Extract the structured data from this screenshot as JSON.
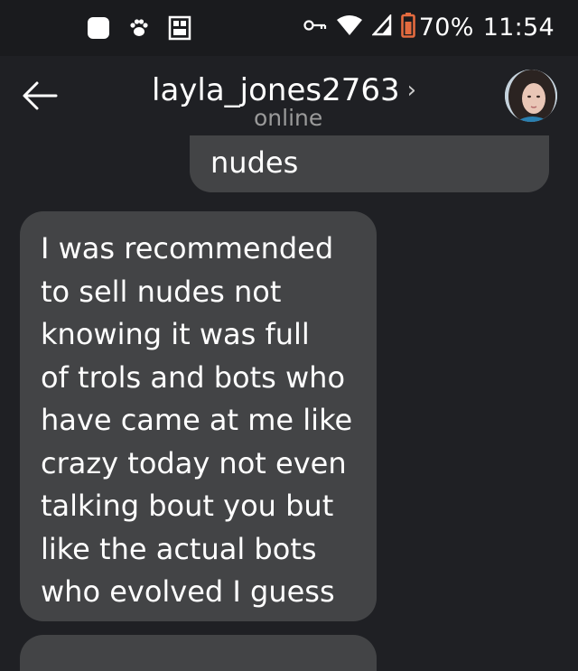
{
  "status_bar": {
    "battery_percent": "70%",
    "time": "11:54",
    "left_icons": [
      "app-notification-icon",
      "paw-icon",
      "gallery-icon"
    ],
    "right_icons": [
      "vpn-key-icon",
      "wifi-icon",
      "signal-icon",
      "battery-icon"
    ]
  },
  "header": {
    "back_icon": "arrow-left-icon",
    "username": "layla_jones2763",
    "chevron": "›",
    "status": "online"
  },
  "messages": [
    {
      "direction": "sent",
      "lines": [
        "nudes"
      ]
    },
    {
      "direction": "received",
      "lines": [
        "I was recommended",
        "to sell nudes not",
        "knowing it was full",
        "of trols and bots who",
        "have came at me like",
        "crazy today not even",
        "talking bout you but",
        "like the actual bots",
        "who evolved I guess"
      ]
    }
  ],
  "colors": {
    "background": "#1f2024",
    "status_bar": "#1a1b1e",
    "bubble": "#434446",
    "secondary_text": "#9a9a9a"
  }
}
